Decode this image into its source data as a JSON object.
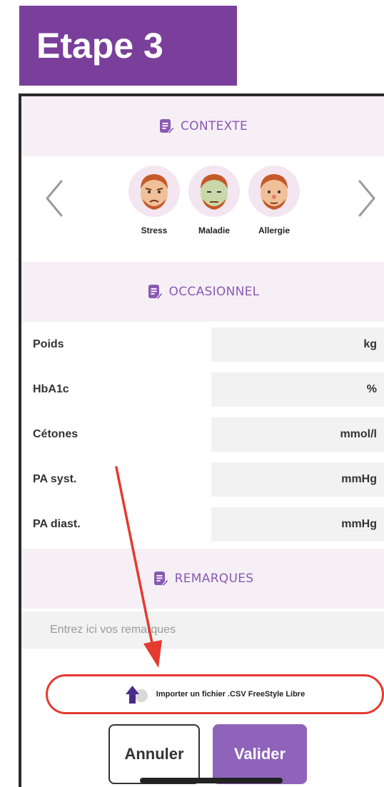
{
  "step_banner": {
    "title": "Etape 3",
    "color": "#7a3f9a"
  },
  "sections": {
    "context": {
      "title": "CONTEXTE",
      "icon": "notes-edit-icon"
    },
    "occasional": {
      "title": "OCCASIONNEL",
      "icon": "notes-edit-icon"
    },
    "remarks": {
      "title": "REMARQUES",
      "icon": "notes-edit-icon"
    }
  },
  "context_items": [
    {
      "label": "Stress",
      "icon": "stressed-face-icon"
    },
    {
      "label": "Maladie",
      "icon": "sick-face-icon"
    },
    {
      "label": "Allergie",
      "icon": "allergy-face-icon"
    }
  ],
  "carousel": {
    "prev_icon": "chevron-left-icon",
    "next_icon": "chevron-right-icon"
  },
  "measurements": [
    {
      "label": "Poids",
      "unit": "kg",
      "value": ""
    },
    {
      "label": "HbA1c",
      "unit": "%",
      "value": ""
    },
    {
      "label": "Cétones",
      "unit": "mmol/l",
      "value": ""
    },
    {
      "label": "PA syst.",
      "unit": "mmHg",
      "value": ""
    },
    {
      "label": "PA diast.",
      "unit": "mmHg",
      "value": ""
    }
  ],
  "remarks": {
    "placeholder": "Entrez ici vos remarques",
    "value": ""
  },
  "import": {
    "label": "Importer un fichier .CSV FreeStyle Libre",
    "icon": "upload-arrow-icon"
  },
  "actions": {
    "cancel_label": "Annuler",
    "validate_label": "Valider"
  },
  "colors": {
    "accent": "#8e63b9",
    "section_background": "#f6f0f6",
    "annotation_red": "#e43a30"
  }
}
